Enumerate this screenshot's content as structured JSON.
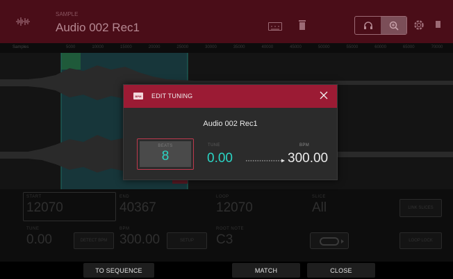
{
  "header": {
    "small_label": "SAMPLE",
    "title": "Audio 002 Rec1"
  },
  "ruler": {
    "label": "Samples",
    "ticks": [
      "5000",
      "10000",
      "15000",
      "20000",
      "25000",
      "30000",
      "35000",
      "40000",
      "45000",
      "50000",
      "55000",
      "60000",
      "65000",
      "70000",
      "75000"
    ]
  },
  "params": {
    "start_label": "START",
    "start_value": "12070",
    "end_label": "END",
    "end_value": "40367",
    "loop_label": "LOOP",
    "loop_value": "12070",
    "slice_label": "SLICE",
    "slice_value": "All",
    "tune_label": "TUNE",
    "tune_value": "0.00",
    "detect_label": "DETECT BPM",
    "bpm_label": "BPM",
    "bpm_value": "300.00",
    "root_label": "ROOT NOTE",
    "root_value": "C3",
    "setup_label": "SETUP",
    "link_slices": "LINK SLICES",
    "loop_lock": "LOOP LOCK"
  },
  "footer": {
    "to_sequence": "TO SEQUENCE",
    "match": "MATCH",
    "close": "CLOSE"
  },
  "modal": {
    "badge": "BPM",
    "title": "EDIT TUNING",
    "sample_name": "Audio 002 Rec1",
    "beats_label": "BEATS",
    "beats_value": "8",
    "tune_label": "TUNE",
    "tune_value": "0.00",
    "bpm_label": "BPM",
    "bpm_value": "300.00"
  },
  "colors": {
    "header_bg": "#4a0d18",
    "modal_header": "#9b1b34",
    "accent_teal": "#2bd4c4",
    "beats_border": "#c0394e"
  },
  "icons": {
    "sample_icon": "waveform-icon",
    "keyboard": "keyboard-icon",
    "trash": "trash-icon",
    "headphones": "headphones-icon",
    "zoom": "zoom-icon",
    "settings": "gear-icon",
    "close": "close-icon",
    "arrow": "dotted-arrow-icon",
    "loop_play": "loop-play-icon"
  }
}
